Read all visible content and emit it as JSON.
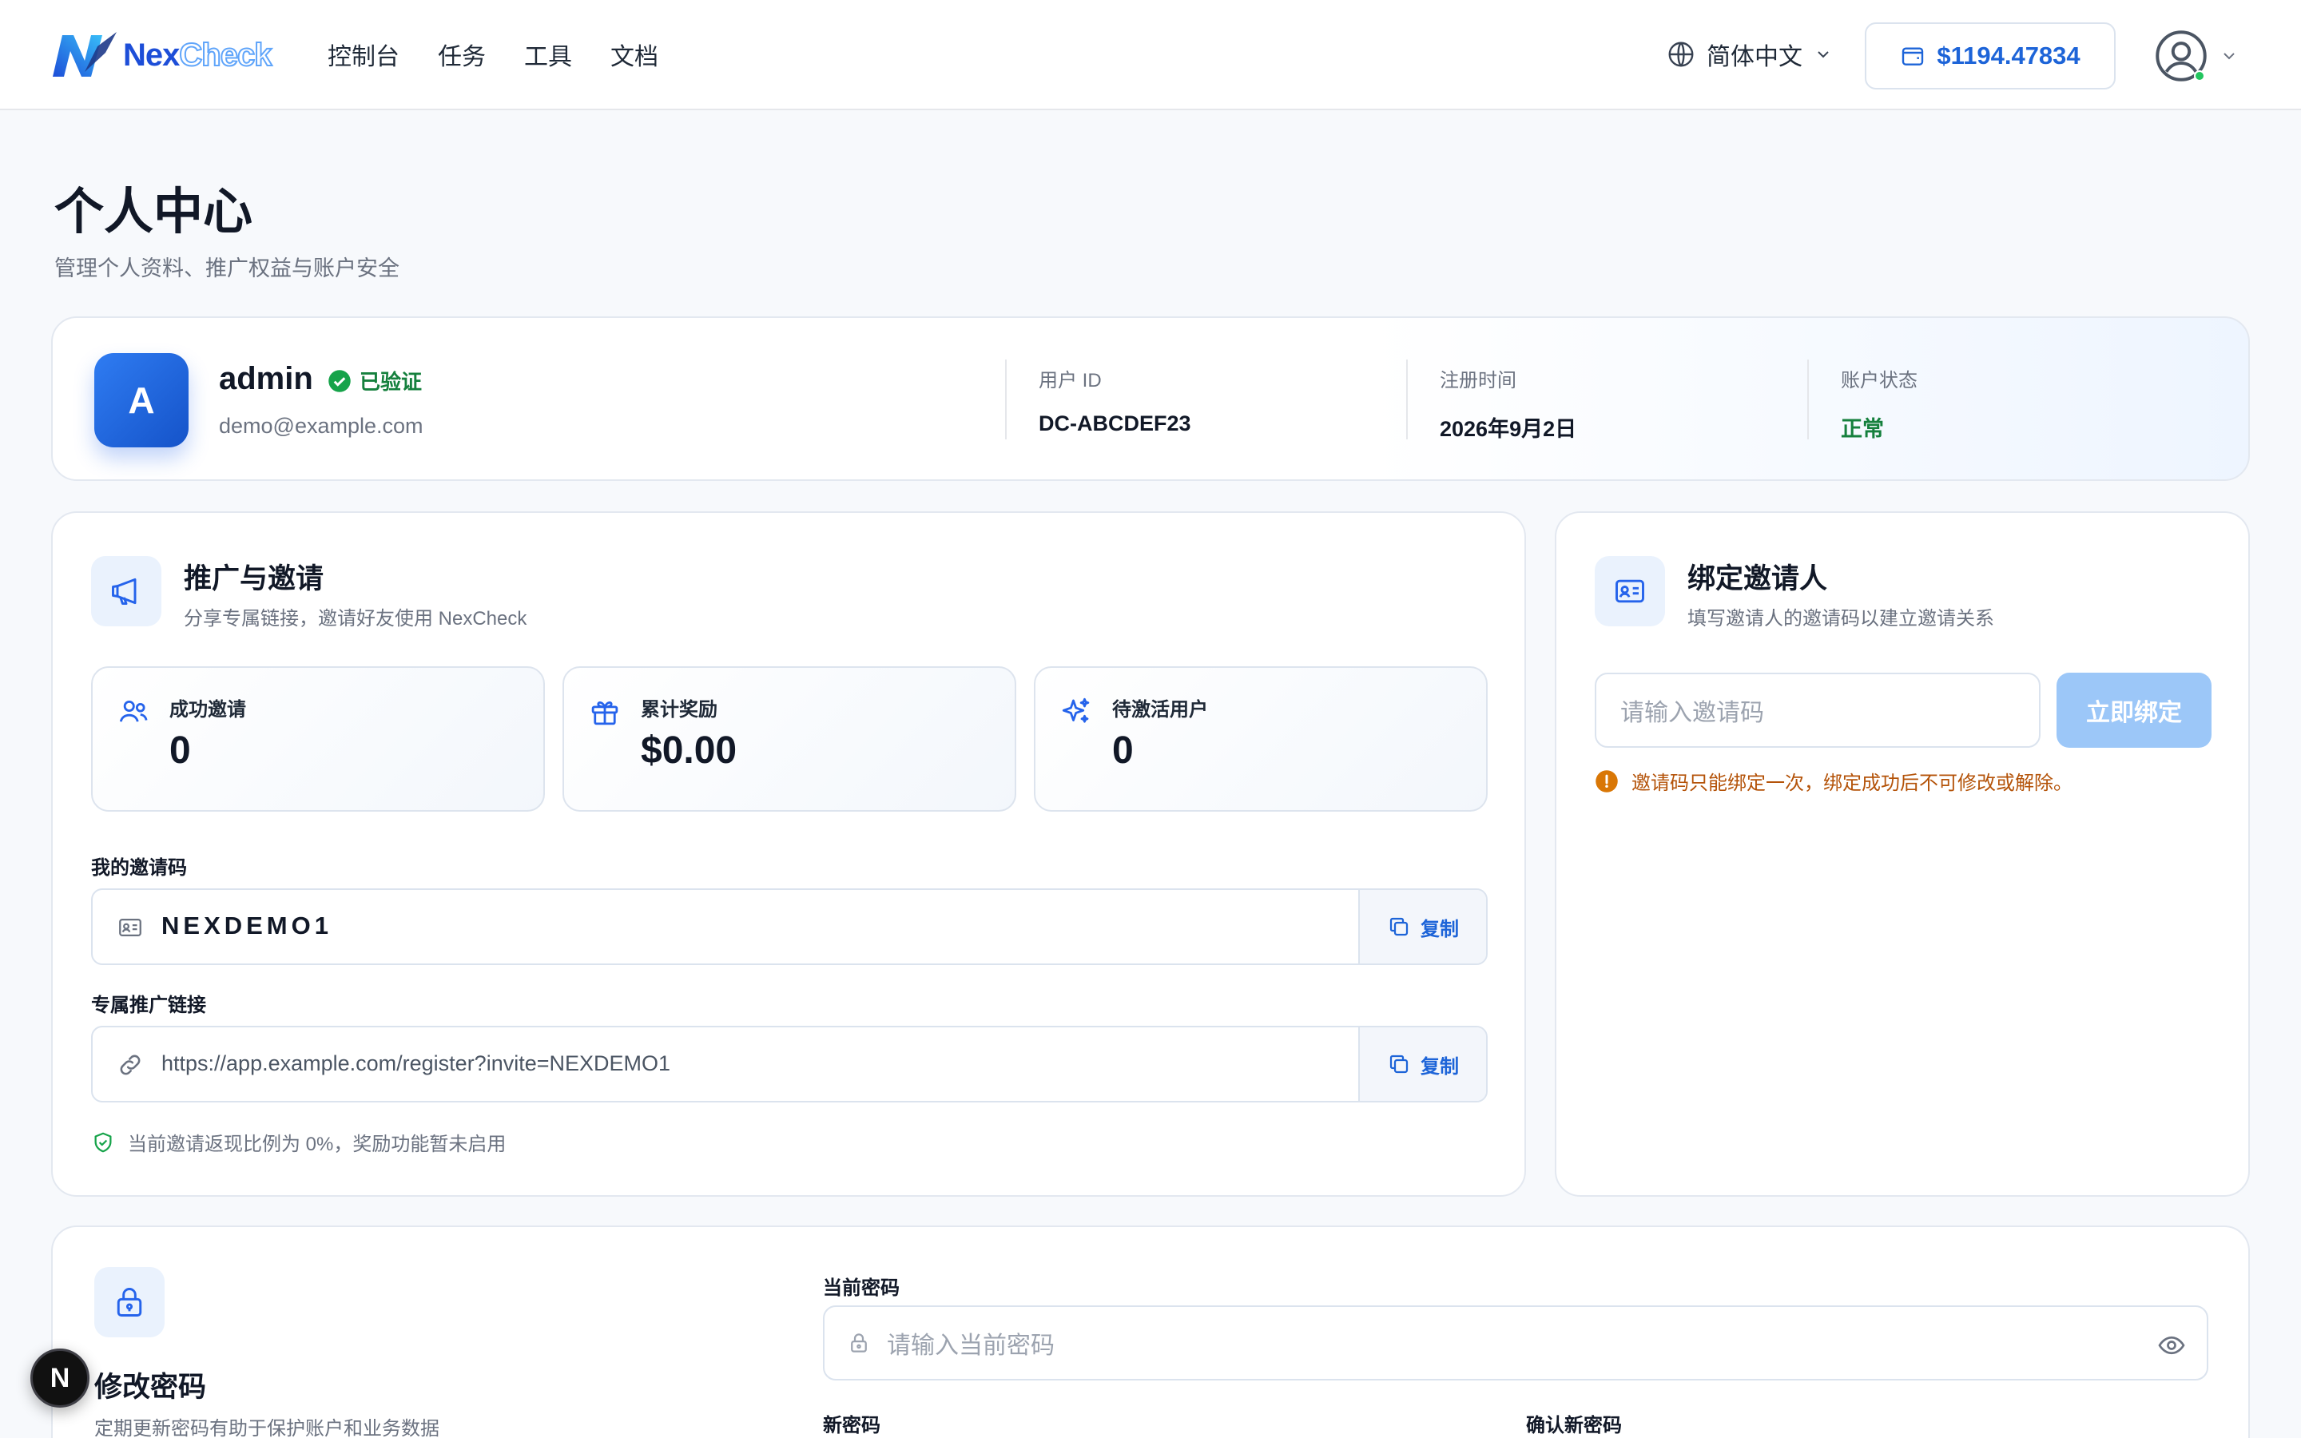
{
  "brand": {
    "name_part1": "Nex",
    "name_part2": "Check"
  },
  "nav": {
    "items": [
      {
        "label": "控制台"
      },
      {
        "label": "任务"
      },
      {
        "label": "工具"
      },
      {
        "label": "文档"
      }
    ]
  },
  "header": {
    "language": "简体中文",
    "balance": "$1194.47834",
    "accent_color": "#1d64d8"
  },
  "page": {
    "title": "个人中心",
    "subtitle": "管理个人资料、推广权益与账户安全"
  },
  "profile": {
    "avatar_letter": "A",
    "username": "admin",
    "verified_label": "已验证",
    "email": "demo@example.com",
    "user_id_label": "用户 ID",
    "user_id": "DC-ABCDEF23",
    "register_label": "注册时间",
    "register_date": "2026年9月2日",
    "status_label": "账户状态",
    "status": "正常",
    "status_color": "#15803d"
  },
  "promo": {
    "title": "推广与邀请",
    "subtitle": "分享专属链接，邀请好友使用 NexCheck",
    "stats": [
      {
        "label": "成功邀请",
        "value": "0",
        "icon": "users-icon"
      },
      {
        "label": "累计奖励",
        "value": "$0.00",
        "icon": "gift-icon"
      },
      {
        "label": "待激活用户",
        "value": "0",
        "icon": "sparkles-icon"
      }
    ],
    "code_label": "我的邀请码",
    "code": "NEXDEMO1",
    "link_label": "专属推广链接",
    "link": "https://app.example.com/register?invite=NEXDEMO1",
    "copy_label": "复制",
    "note": "当前邀请返现比例为 0%，奖励功能暂未启用"
  },
  "bind": {
    "title": "绑定邀请人",
    "subtitle": "填写邀请人的邀请码以建立邀请关系",
    "input_placeholder": "请输入邀请码",
    "button_label": "立即绑定",
    "warning": "邀请码只能绑定一次，绑定成功后不可修改或解除。",
    "warning_color": "#b45309"
  },
  "password": {
    "title": "修改密码",
    "subtitle": "定期更新密码有助于保护账户和业务数据",
    "current_label": "当前密码",
    "current_placeholder": "请输入当前密码",
    "new_label": "新密码",
    "confirm_label": "确认新密码"
  },
  "fab": {
    "letter": "N"
  }
}
